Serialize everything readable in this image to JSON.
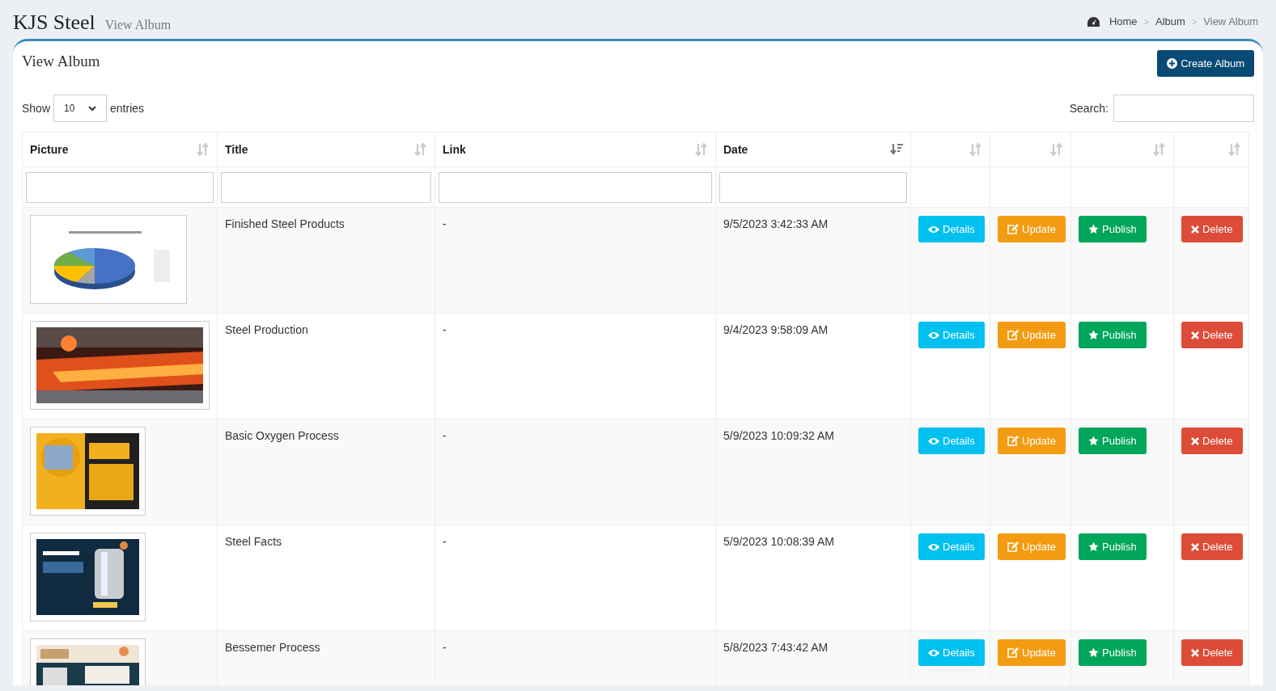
{
  "header": {
    "title": "KJS Steel",
    "subtitle": "View Album"
  },
  "breadcrumb": [
    {
      "label": "Home",
      "selected": false
    },
    {
      "label": "Album",
      "selected": false
    },
    {
      "label": "View Album",
      "selected": true
    }
  ],
  "breadcrumb_separator": ">",
  "card": {
    "title": "View Album",
    "create_button": "Create Album"
  },
  "length_menu": {
    "before": "Show",
    "value": "10",
    "after": "entries"
  },
  "search": {
    "label": "Search:"
  },
  "table": {
    "columns": [
      {
        "label": "Picture",
        "sorted": false
      },
      {
        "label": "Title",
        "sorted": false
      },
      {
        "label": "Link",
        "sorted": false
      },
      {
        "label": "Date",
        "sorted": true
      },
      {
        "sorted": false
      },
      {
        "sorted": false
      },
      {
        "sorted": false
      },
      {
        "sorted": false
      }
    ],
    "rows": [
      {
        "picture": {
          "kind": "picture"
        },
        "title": "Finished Steel Products",
        "link": "-",
        "date": "9/5/2023 3:42:33 AM",
        "actions": [
          "Details",
          "Update",
          "Publish",
          "Delete"
        ]
      },
      {
        "picture": {
          "kind": "picture"
        },
        "title": "Steel Production",
        "link": "-",
        "date": "9/4/2023 9:58:09 AM",
        "actions": [
          "Details",
          "Update",
          "Publish",
          "Delete"
        ]
      },
      {
        "picture": {
          "kind": "picture"
        },
        "title": "Basic Oxygen Process",
        "link": "-",
        "date": "5/9/2023 10:09:32 AM",
        "actions": [
          "Details",
          "Update",
          "Publish",
          "Delete"
        ]
      },
      {
        "picture": {
          "kind": "picture"
        },
        "title": "Steel Facts",
        "link": "-",
        "date": "5/9/2023 10:08:39 AM",
        "actions": [
          "Details",
          "Update",
          "Publish",
          "Delete"
        ]
      },
      {
        "picture": {
          "kind": "picture"
        },
        "title": "Bessemer Process",
        "link": "-",
        "date": "5/8/2023 7:43:42 AM",
        "actions": [
          "Details",
          "Update",
          "Publish",
          "Delete"
        ]
      }
    ]
  }
}
